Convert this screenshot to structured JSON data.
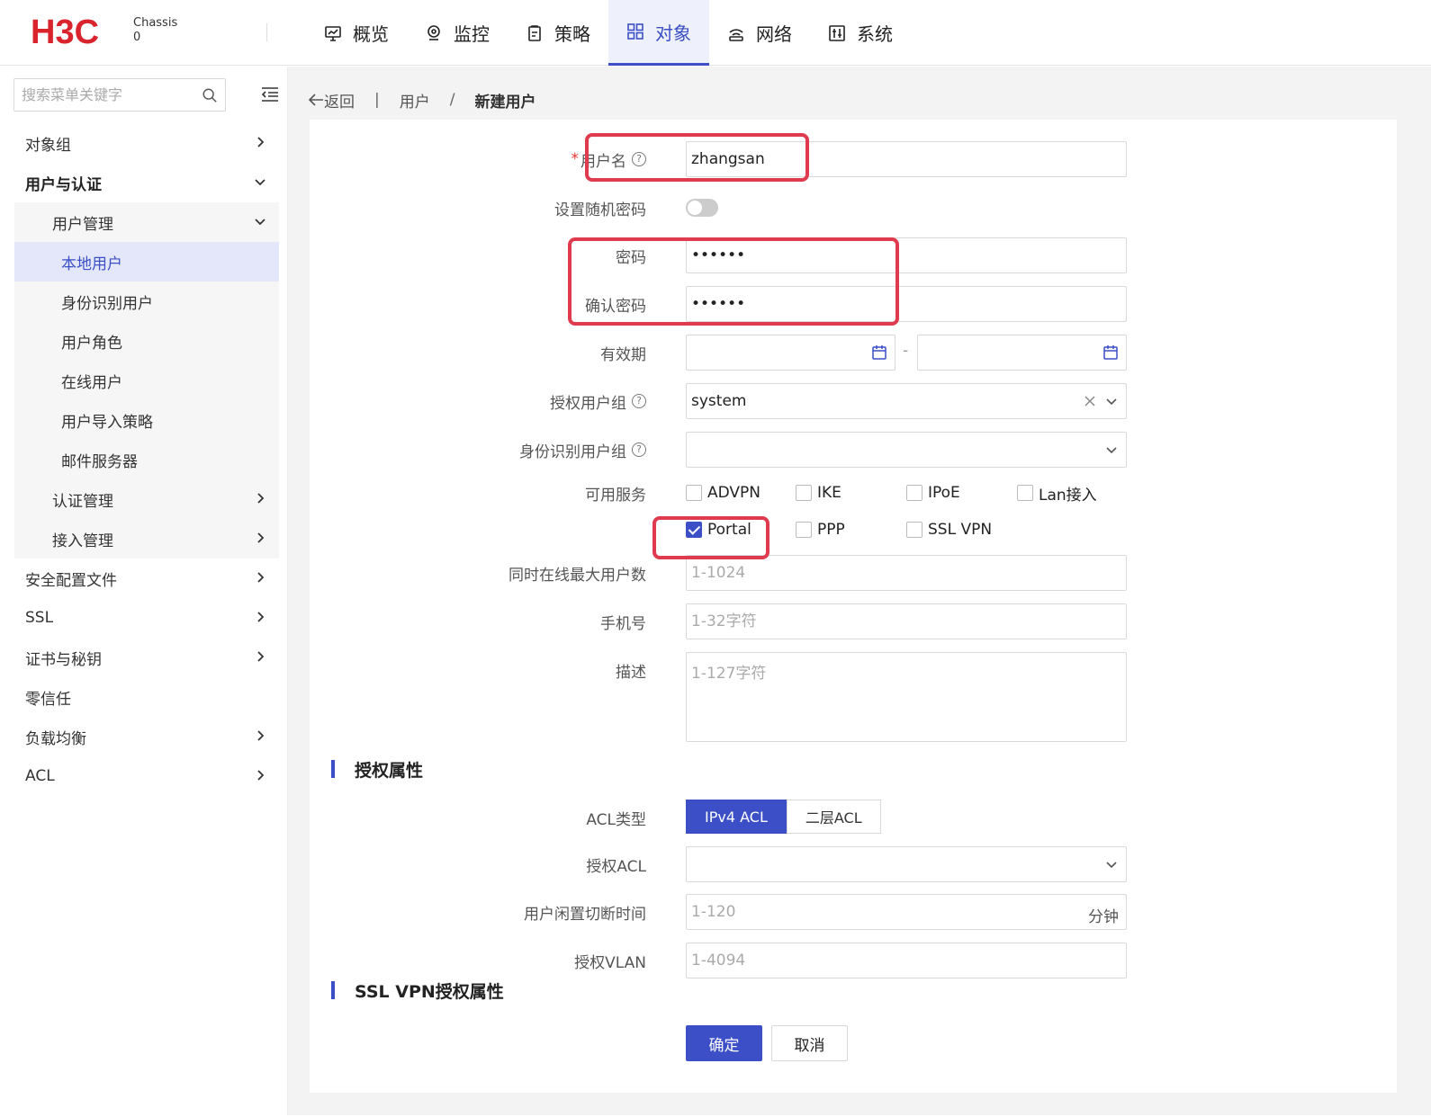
{
  "header": {
    "logo_text": "H3C",
    "chassis_label": "Chassis",
    "chassis_value": "0",
    "nav": [
      {
        "label": "概览",
        "icon": "monitor-icon"
      },
      {
        "label": "监控",
        "icon": "location-icon"
      },
      {
        "label": "策略",
        "icon": "clipboard-icon"
      },
      {
        "label": "对象",
        "icon": "grid-icon"
      },
      {
        "label": "网络",
        "icon": "network-icon"
      },
      {
        "label": "系统",
        "icon": "system-icon"
      }
    ],
    "active_nav": "对象"
  },
  "sidebar": {
    "search_placeholder": "搜索菜单关键字",
    "items": [
      {
        "label": "对象组",
        "level": 1,
        "chevron": "right"
      },
      {
        "label": "用户与认证",
        "level": 1,
        "chevron": "down"
      },
      {
        "label": "用户管理",
        "level": 2,
        "chevron": "down"
      },
      {
        "label": "本地用户",
        "level": 3,
        "active": true
      },
      {
        "label": "身份识别用户",
        "level": 3
      },
      {
        "label": "用户角色",
        "level": 3
      },
      {
        "label": "在线用户",
        "level": 3
      },
      {
        "label": "用户导入策略",
        "level": 3
      },
      {
        "label": "邮件服务器",
        "level": 3
      },
      {
        "label": "认证管理",
        "level": 2,
        "chevron": "right"
      },
      {
        "label": "接入管理",
        "level": 2,
        "chevron": "right"
      },
      {
        "label": "安全配置文件",
        "level": 1,
        "chevron": "right"
      },
      {
        "label": "SSL",
        "level": 1,
        "chevron": "right"
      },
      {
        "label": "证书与秘钥",
        "level": 1,
        "chevron": "right"
      },
      {
        "label": "零信任",
        "level": 1
      },
      {
        "label": "负载均衡",
        "level": 1,
        "chevron": "right"
      },
      {
        "label": "ACL",
        "level": 1,
        "chevron": "right"
      }
    ]
  },
  "breadcrumb": {
    "back": "返回",
    "parent": "用户",
    "separator": "/",
    "current": "新建用户"
  },
  "form": {
    "username_label": "用户名",
    "username_required": "*",
    "username_value": "zhangsan",
    "random_pwd_label": "设置随机密码",
    "password_label": "密码",
    "password_value": "••••••",
    "confirm_label": "确认密码",
    "confirm_value": "••••••",
    "validity_label": "有效期",
    "validity_separator": "-",
    "auth_group_label": "授权用户组",
    "auth_group_value": "system",
    "identity_group_label": "身份识别用户组",
    "services_label": "可用服务",
    "services": [
      {
        "label": "ADVPN",
        "checked": false
      },
      {
        "label": "IKE",
        "checked": false
      },
      {
        "label": "IPoE",
        "checked": false
      },
      {
        "label": "Lan接入",
        "checked": false
      },
      {
        "label": "Portal",
        "checked": true
      },
      {
        "label": "PPP",
        "checked": false
      },
      {
        "label": "SSL VPN",
        "checked": false
      }
    ],
    "max_online_label": "同时在线最大用户数",
    "max_online_placeholder": "1-1024",
    "phone_label": "手机号",
    "phone_placeholder": "1-32字符",
    "desc_label": "描述",
    "desc_placeholder": "1-127字符"
  },
  "auth_section": {
    "title": "授权属性",
    "acl_type_label": "ACL类型",
    "acl_type_options": [
      "IPv4 ACL",
      "二层ACL"
    ],
    "acl_type_selected": "IPv4 ACL",
    "auth_acl_label": "授权ACL",
    "idle_label": "用户闲置切断时间",
    "idle_placeholder": "1-120",
    "idle_unit": "分钟",
    "vlan_label": "授权VLAN",
    "vlan_placeholder": "1-4094"
  },
  "sslvpn_section": {
    "title": "SSL VPN授权属性"
  },
  "buttons": {
    "ok": "确定",
    "cancel": "取消"
  },
  "colors": {
    "accent": "#3c4fc6",
    "highlight": "#e03a4e"
  }
}
